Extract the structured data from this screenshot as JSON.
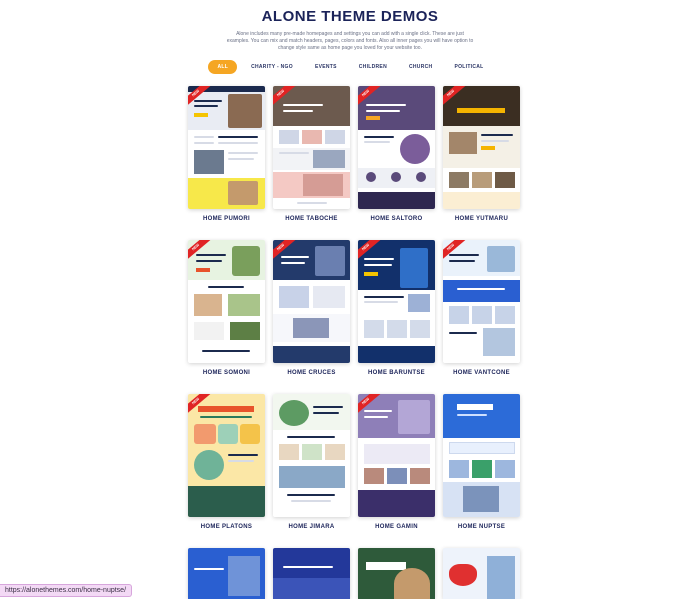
{
  "header": {
    "title": "ALONE THEME DEMOS",
    "description": "Alone includes many pre-made homepages and settings you can add with a single click. These are just examples. You can mix and match headers, pages, colors and fonts. Also all inner pages you will have option to change style same as home page you loved for your website too."
  },
  "filters": [
    {
      "label": "ALL",
      "active": true
    },
    {
      "label": "CHARITY - NGO",
      "active": false
    },
    {
      "label": "EVENTS",
      "active": false
    },
    {
      "label": "CHILDREN",
      "active": false
    },
    {
      "label": "CHURCH",
      "active": false
    },
    {
      "label": "POLITICAL",
      "active": false
    }
  ],
  "ribbon_text": "NEW",
  "demos": [
    {
      "label": "HOME PUMORI",
      "ribbon": true
    },
    {
      "label": "HOME TABOCHE",
      "ribbon": true
    },
    {
      "label": "HOME SALTORO",
      "ribbon": true
    },
    {
      "label": "HOME YUTMARU",
      "ribbon": true
    },
    {
      "label": "HOME SOMONI",
      "ribbon": true
    },
    {
      "label": "HOME CRUCES",
      "ribbon": true
    },
    {
      "label": "HOME BARUNTSE",
      "ribbon": true
    },
    {
      "label": "HOME VANTCONE",
      "ribbon": true
    },
    {
      "label": "HOME PLATONS",
      "ribbon": true
    },
    {
      "label": "HOME JIMARA",
      "ribbon": false
    },
    {
      "label": "HOME GAMIN",
      "ribbon": true
    },
    {
      "label": "HOME NUPTSE",
      "ribbon": false
    }
  ],
  "status_url": "https://alonethemes.com/home-nuptse/",
  "colors": {
    "accent": "#f5a623",
    "title": "#1b2359",
    "ribbon": "#e02424"
  }
}
